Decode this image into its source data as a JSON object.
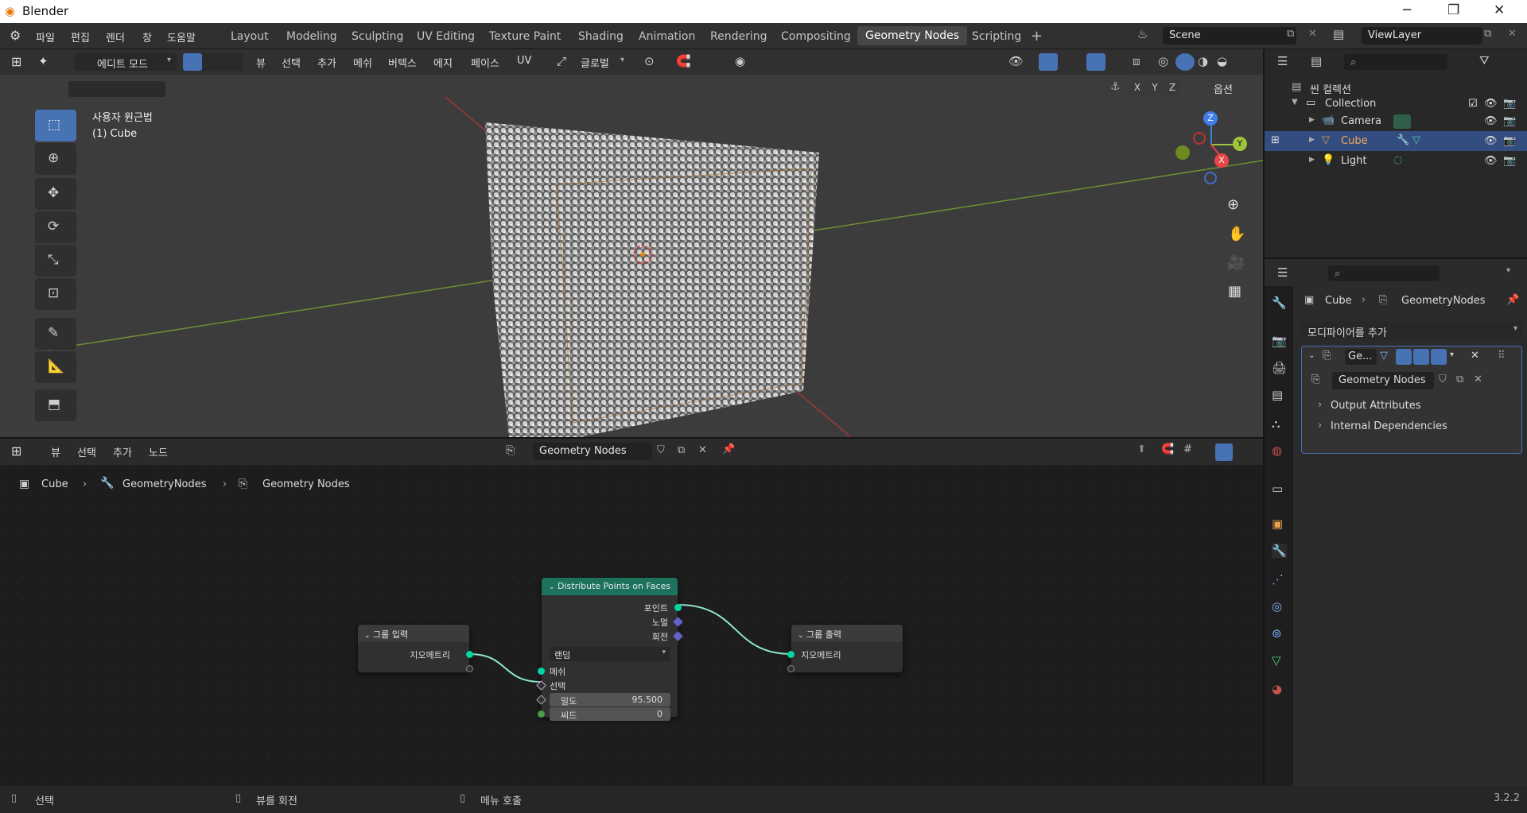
{
  "window": {
    "title": "Blender"
  },
  "menu": [
    "파일",
    "편집",
    "렌더",
    "창",
    "도움말"
  ],
  "workspaces": [
    "Layout",
    "Modeling",
    "Sculpting",
    "UV Editing",
    "Texture Paint",
    "Shading",
    "Animation",
    "Rendering",
    "Compositing",
    "Geometry Nodes",
    "Scripting"
  ],
  "scene": {
    "scene_name": "Scene",
    "view_layer": "ViewLayer"
  },
  "viewport": {
    "mode": "에디트 모드",
    "menus": [
      "뷰",
      "선택",
      "추가",
      "메쉬",
      "버텍스",
      "에지",
      "페이스",
      "UV"
    ],
    "transform": "글로벌",
    "options": "옵션",
    "axes": [
      "X",
      "Y",
      "Z"
    ],
    "overlay_title": "사용자 원근법",
    "overlay_object": "(1) Cube",
    "gizmo": {
      "x": "X",
      "y": "Y",
      "z": "Z"
    }
  },
  "outliner": {
    "scene_collection": "씬 컬렉션",
    "collection": "Collection",
    "items": [
      {
        "name": "Camera",
        "selected": false
      },
      {
        "name": "Cube",
        "selected": true
      },
      {
        "name": "Light",
        "selected": false
      }
    ]
  },
  "properties": {
    "breadcrumb_object": "Cube",
    "breadcrumb_modifier": "GeometryNodes",
    "add_modifier": "모디파이어를 추가",
    "modifier_short": "Ge...",
    "node_group": "Geometry Nodes",
    "panels": [
      "Output Attributes",
      "Internal Dependencies"
    ]
  },
  "node_editor": {
    "menus": [
      "뷰",
      "선택",
      "추가",
      "노드"
    ],
    "tree_name": "Geometry Nodes",
    "breadcrumb": [
      "Cube",
      "GeometryNodes",
      "Geometry Nodes"
    ]
  },
  "nodes": {
    "group_input": {
      "title": "그룹 입력",
      "output": "지오메트리"
    },
    "distribute": {
      "title": "Distribute Points on Faces",
      "outputs": [
        "포인트",
        "노멀",
        "회전"
      ],
      "mode": "랜덤",
      "inputs": [
        "메쉬",
        "선택"
      ],
      "density_label": "밀도",
      "density_value": "95.500",
      "seed_label": "씨드",
      "seed_value": "0"
    },
    "group_output": {
      "title": "그룹 출력",
      "input": "지오메트리"
    }
  },
  "status": {
    "select": "선택",
    "rotate": "뷰를 회전",
    "menu": "메뉴 호출",
    "version": "3.2.2"
  },
  "colors": {
    "accent": "#4772b3",
    "geometry_socket": "#00d6a3",
    "node_header": "#1d725e"
  }
}
